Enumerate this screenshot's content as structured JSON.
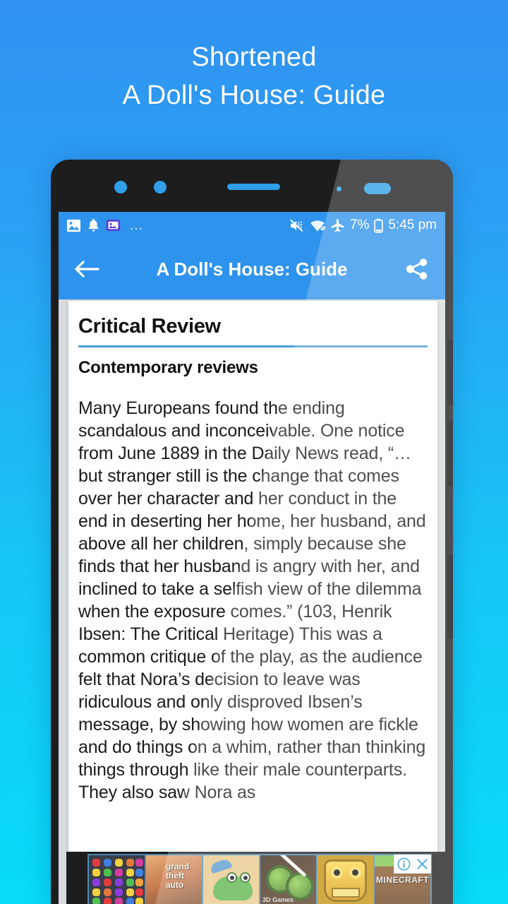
{
  "promo": {
    "line1": "Shortened",
    "line2": "A Doll's House: Guide"
  },
  "device": {
    "hardware": {
      "camera_1": "camera-lens",
      "camera_2": "camera-lens",
      "earpiece": "speaker-grill",
      "proximity_sensor": "sensor-dot",
      "led_indicator": "sensor-pill",
      "side_button_1": "volume-up-button",
      "side_button_2": "volume-down-button",
      "side_button_3": "power-button"
    }
  },
  "statusbar": {
    "left_icons": [
      "photo-icon",
      "bell-icon",
      "news-app-icon"
    ],
    "overflow": "…",
    "right_icons": [
      "mute-icon",
      "wifi-icon",
      "airplane-mode-icon"
    ],
    "battery_percent": "7%",
    "battery_icon": "battery-icon",
    "time": "5:45 pm"
  },
  "appbar": {
    "back_icon": "arrow-left-icon",
    "title": "A Doll's House: Guide",
    "share_icon": "share-icon",
    "background_color": "#2e93ec"
  },
  "content": {
    "heading": "Critical Review",
    "subheading": "Contemporary reviews",
    "rule_color": "#4a9fd8",
    "paragraph": "Many Europeans found the ending scandalous and inconceivable. One notice from June 1889 in the Daily News read, “…but stranger still is the change that comes over her character and her conduct in the end in deserting her home, her husband, and above all her children, simply because she finds that her husband is angry with her, and inclined to take a selfish view of the dilemma when the exposure comes.” (103, Henrik Ibsen: The Critical Heritage) This was a common critique of the play, as the audience felt that Nora’s decision to leave was ridiculous and only disproved Ibsen’s message, by showing how women are fickle and do things on a whim, rather than thinking things through like their male counterparts. They also saw Nora as"
  },
  "ad": {
    "thumbnails": [
      {
        "name": "candy-crush-thumb"
      },
      {
        "name": "grand-theft-auto-thumb",
        "label": "grand\ntheft\nauto"
      },
      {
        "name": "crocodile-game-thumb"
      },
      {
        "name": "fruit-ninja-thumb",
        "label": "3D Games"
      },
      {
        "name": "temple-run-thumb"
      },
      {
        "name": "minecraft-thumb",
        "label": "MINECRAFT"
      }
    ],
    "info_icon": "info-icon",
    "close_icon": "close-icon"
  },
  "colors": {
    "background_top": "#3192f2",
    "background_bottom": "#07dbf7",
    "accent": "#2e93ec"
  }
}
